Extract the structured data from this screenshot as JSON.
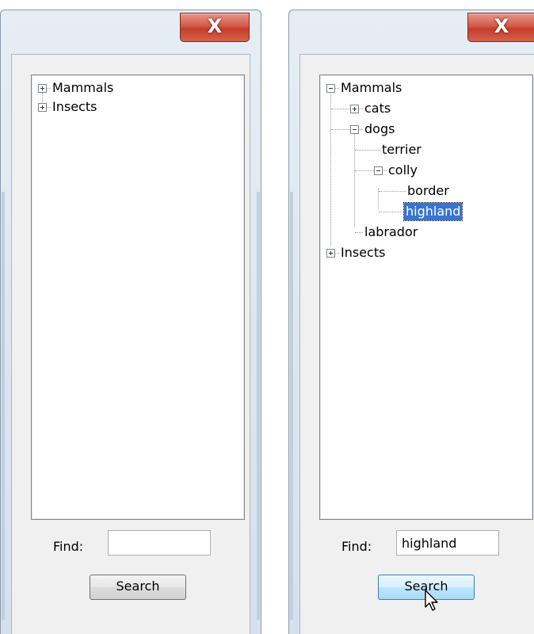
{
  "left_window": {
    "close_glyph": "X",
    "tree": [
      {
        "label": "Mammals",
        "expander": "plus"
      },
      {
        "label": "Insects",
        "expander": "plus"
      }
    ],
    "find_label": "Find:",
    "find_value": "",
    "search_label": "Search"
  },
  "right_window": {
    "close_glyph": "X",
    "tree": [
      {
        "label": "Mammals",
        "expander": "minus",
        "depth": 0
      },
      {
        "label": "cats",
        "expander": "plus",
        "depth": 1
      },
      {
        "label": "dogs",
        "expander": "minus",
        "depth": 1
      },
      {
        "label": "terrier",
        "expander": "none",
        "depth": 2
      },
      {
        "label": "colly",
        "expander": "minus",
        "depth": 2
      },
      {
        "label": "border",
        "expander": "none",
        "depth": 3
      },
      {
        "label": "highland",
        "expander": "none",
        "depth": 3,
        "selected": true
      },
      {
        "label": "labrador",
        "expander": "none",
        "depth": 2
      },
      {
        "label": "Insects",
        "expander": "plus",
        "depth": 0
      }
    ],
    "find_label": "Find:",
    "find_value": "highland",
    "search_label": "Search"
  },
  "colors": {
    "selection": "#3874d3",
    "close_button": "#c33e2b"
  }
}
